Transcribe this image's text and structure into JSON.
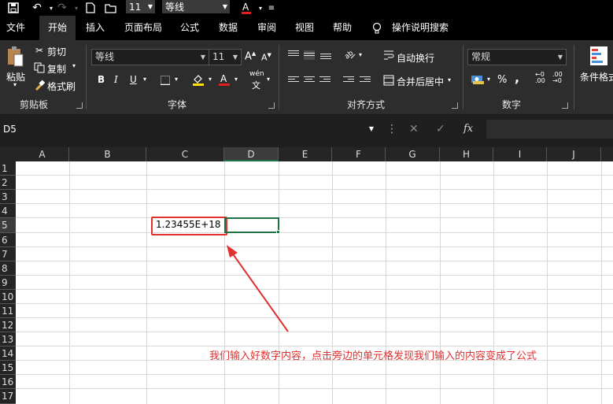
{
  "qat": {
    "font_size": "11",
    "font_name": "等线"
  },
  "tabs": [
    "文件",
    "开始",
    "插入",
    "页面布局",
    "公式",
    "数据",
    "审阅",
    "视图",
    "帮助",
    "操作说明搜索"
  ],
  "ribbon": {
    "clipboard": {
      "paste": "粘贴",
      "cut": "剪切",
      "copy": "复制",
      "format_painter": "格式刷",
      "label": "剪贴板"
    },
    "font": {
      "name": "等线",
      "size": "11",
      "bold": "B",
      "italic": "I",
      "underline": "U",
      "label": "字体",
      "phonetic": "wén"
    },
    "alignment": {
      "wrap_text": "自动换行",
      "merge_center": "合并后居中",
      "label": "对齐方式"
    },
    "number": {
      "format": "常规",
      "percent": "%",
      "comma": ",",
      "inc_decimal": ".00",
      "dec_decimal": ".00",
      "label": "数字"
    },
    "styles": {
      "conditional": "条件格式"
    }
  },
  "formula_bar": {
    "name_box": "D5",
    "fx": "fx"
  },
  "columns": [
    "A",
    "B",
    "C",
    "D",
    "E",
    "F",
    "G",
    "H",
    "I",
    "J"
  ],
  "rows": [
    "1",
    "2",
    "3",
    "4",
    "5",
    "6",
    "7",
    "8",
    "9",
    "10",
    "11",
    "12",
    "13",
    "14",
    "15",
    "16",
    "17"
  ],
  "cells": {
    "C5": "1.23455E+18"
  },
  "annotation": "我们输入好数字内容，点击旁边的单元格发现我们输入的内容变成了公式",
  "colors": {
    "accent_green": "#1e7145",
    "annotation_red": "#e03030"
  }
}
